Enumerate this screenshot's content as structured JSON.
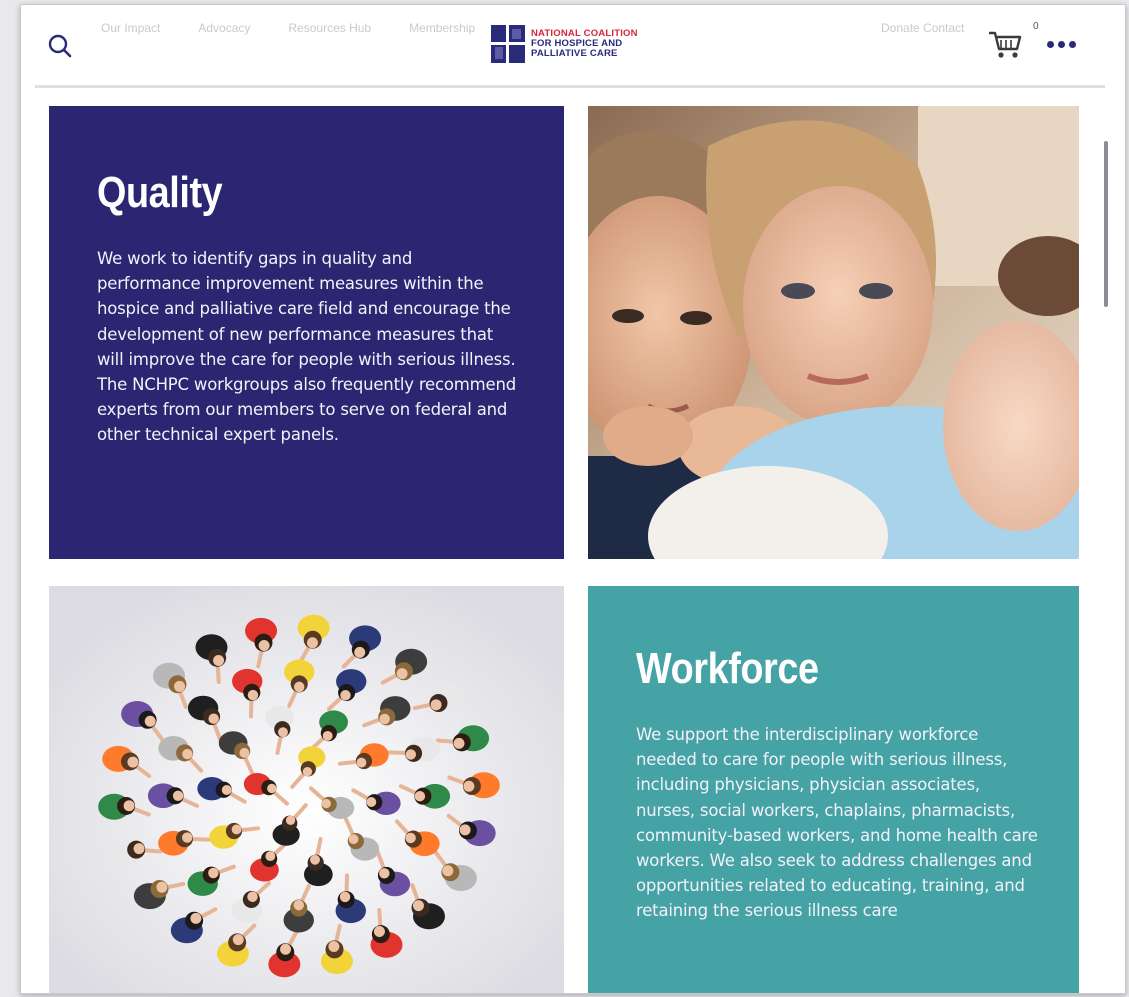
{
  "header": {
    "ghost_nav": [
      "Our Impact",
      "Advocacy",
      "Resources Hub",
      "Membership"
    ],
    "ghost_right": "Donate  Contact",
    "logo": {
      "line1": "NATIONAL COALITION",
      "line2": "FOR HOSPICE AND",
      "line3": "PALLIATIVE CARE"
    },
    "cart_count": "0"
  },
  "tiles": {
    "quality": {
      "title": "Quality",
      "body": "We work to identify gaps in quality and performance improvement measures within the hospice and palliative care field and encourage the development of new performance measures that will improve the care for people with serious illness. The NCHPC workgroups also frequently recommend experts from our members to serve on federal and other technical expert panels."
    },
    "workforce": {
      "title": "Workforce",
      "body": "We support the interdisciplinary workforce needed to care for people with serious illness, including physicians, physician associates, nurses, social workers, chaplains, pharmacists, community-based workers, and home health care workers. We also seek to address challenges and opportunities related to educating, training, and retaining the serious illness care"
    }
  },
  "icons": {
    "search": "search-icon",
    "cart": "cart-icon",
    "more": "more-icon"
  },
  "colors": {
    "quality_bg": "#2a2672",
    "workforce_bg": "#45a2a5",
    "brand_navy": "#2a2a7a",
    "brand_red": "#d8253c"
  }
}
